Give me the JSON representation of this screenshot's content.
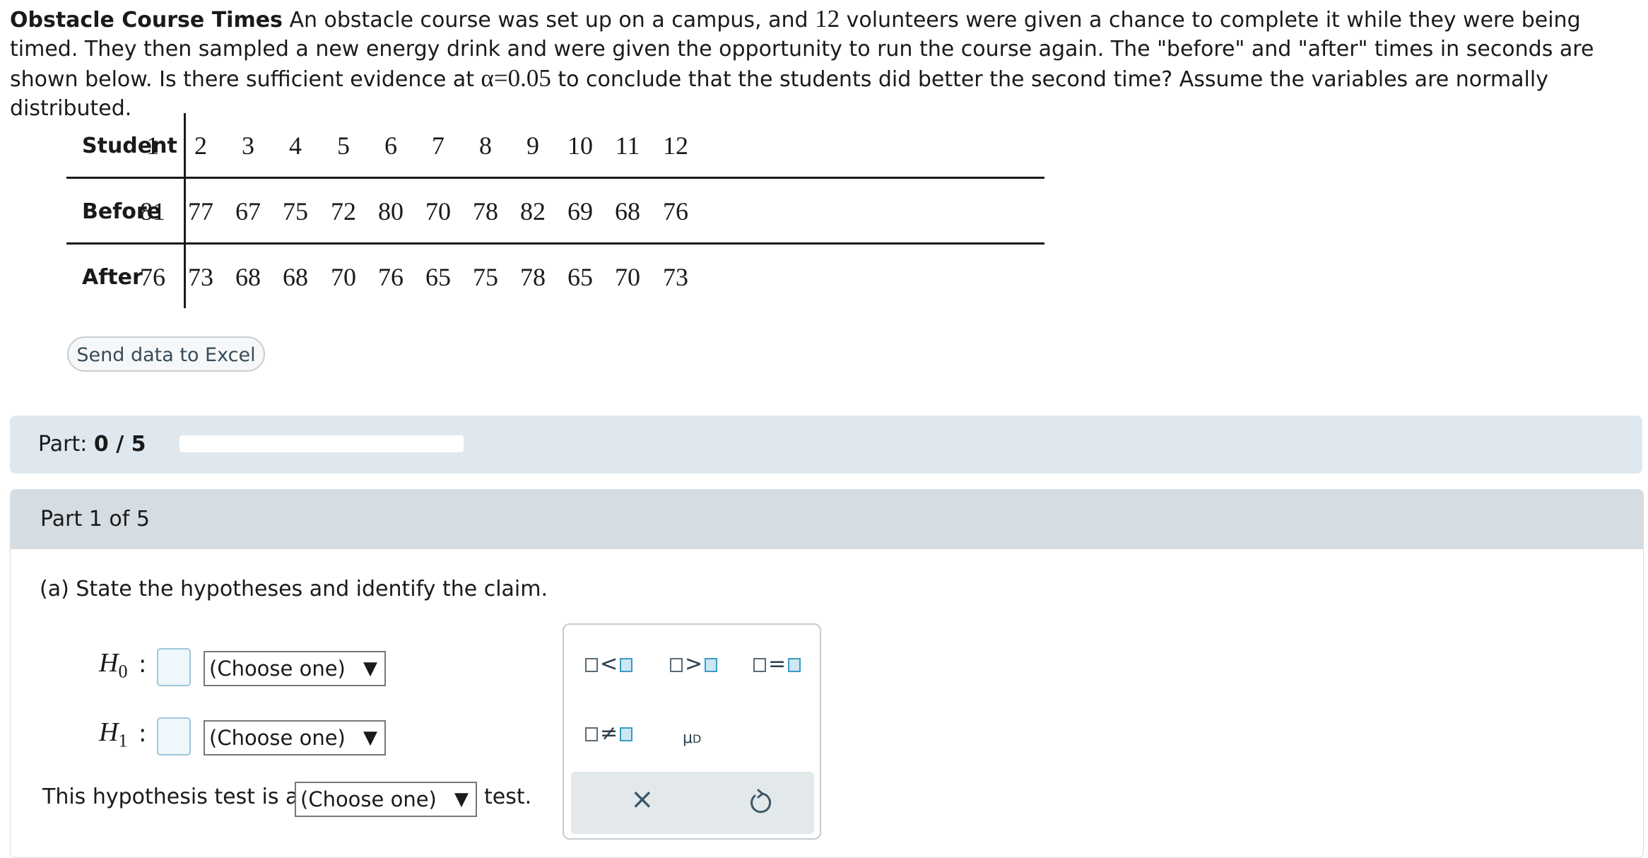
{
  "problem": {
    "title": "Obstacle Course Times",
    "text_1": " An obstacle course was set up on a campus, and ",
    "n": "12",
    "text_2": " volunteers were given a chance to complete it while they were being timed. They then sampled a new energy drink and were given the opportunity to run the course again. The \"before\" and \"after\" times in seconds are shown below. Is there sufficient evidence at ",
    "alpha": "α=0.05",
    "text_3": " to conclude that the students did better the second time? Assume the variables are normally distributed."
  },
  "table": {
    "row_labels": [
      "Student",
      "Before",
      "After"
    ],
    "student": [
      "1",
      "2",
      "3",
      "4",
      "5",
      "6",
      "7",
      "8",
      "9",
      "10",
      "11",
      "12"
    ],
    "before": [
      "81",
      "77",
      "67",
      "75",
      "72",
      "80",
      "70",
      "78",
      "82",
      "69",
      "68",
      "76"
    ],
    "after": [
      "76",
      "73",
      "68",
      "68",
      "70",
      "76",
      "65",
      "75",
      "78",
      "65",
      "70",
      "73"
    ]
  },
  "excel_button": "Send data to Excel",
  "part_progress": {
    "label": "Part:",
    "value": "0 / 5",
    "fraction": 0
  },
  "part": {
    "title": "Part 1 of 5",
    "question": "(a) State the hypotheses and identify the claim.",
    "h0_label": "H",
    "h0_sub": "0",
    "h1_label": "H",
    "h1_sub": "1",
    "colon": ":",
    "h0_select": "(Choose one)",
    "h1_select": "(Choose one)",
    "test_prefix": "This hypothesis test is a",
    "test_select": "(Choose one)",
    "test_suffix": "test."
  },
  "palette": {
    "less": "<",
    "greater": ">",
    "equal": "=",
    "not_equal": "≠",
    "mu": "μ",
    "mu_sub": "D",
    "clear_icon": "×",
    "icons": [
      "less-than-template-icon",
      "greater-than-template-icon",
      "equal-template-icon",
      "not-equal-template-icon",
      "mu-d-icon",
      "clear-icon",
      "undo-icon"
    ]
  }
}
